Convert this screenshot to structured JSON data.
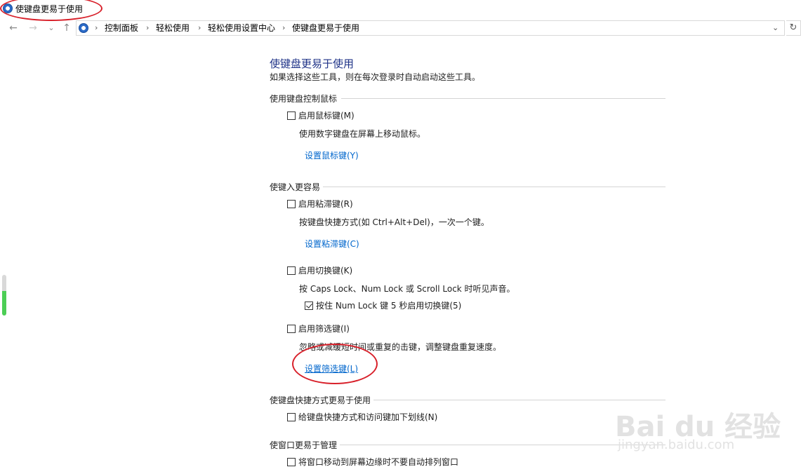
{
  "window": {
    "title": "使键盘更易于使用"
  },
  "nav": {
    "back": "←",
    "forward": "→",
    "recent": "⌄",
    "up": "↑",
    "breadcrumbs": [
      "控制面板",
      "轻松使用",
      "轻松使用设置中心",
      "使键盘更易于使用"
    ],
    "refresh": "↻",
    "dropdown": "⌄"
  },
  "page": {
    "heading": "使键盘更易于使用",
    "description": "如果选择这些工具，则在每次登录时自动启动这些工具。"
  },
  "sections": {
    "mouse": {
      "title": "使用键盘控制鼠标",
      "mouse_keys": {
        "label": "启用鼠标键(M)",
        "checked": false
      },
      "mouse_keys_desc": "使用数字键盘在屏幕上移动鼠标。",
      "mouse_keys_link": "设置鼠标键(Y)"
    },
    "typing": {
      "title": "使键入更容易",
      "sticky_keys": {
        "label": "启用粘滞键(R)",
        "checked": false
      },
      "sticky_keys_desc": "按键盘快捷方式(如 Ctrl+Alt+Del)，一次一个键。",
      "sticky_keys_link": "设置粘滞键(C)",
      "toggle_keys": {
        "label": "启用切换键(K)",
        "checked": false
      },
      "toggle_keys_desc": "按 Caps Lock、Num Lock 或 Scroll Lock 时听见声音。",
      "numlock_hold": {
        "label": "按住 Num Lock 键 5 秒启用切换键(5)",
        "checked": true
      },
      "filter_keys": {
        "label": "启用筛选键(I)",
        "checked": false
      },
      "filter_keys_desc": "忽略或减缓短时间或重复的击键，调整键盘重复速度。",
      "filter_keys_link": "设置筛选键(L)"
    },
    "shortcuts": {
      "title": "使键盘快捷方式更易于使用",
      "underline": {
        "label": "给键盘快捷方式和访问键加下划线(N)",
        "checked": false
      }
    },
    "windows": {
      "title": "使窗口更易于管理",
      "no_arrange": {
        "label": "将窗口移动到屏幕边缘时不要自动排列窗口",
        "checked": false
      }
    }
  },
  "watermark": {
    "brand": "Bai du 经验",
    "url": "jingyan.baidu.com"
  },
  "colors": {
    "heading": "#1e3287",
    "link": "#0066cc",
    "annotation": "#d8202a"
  }
}
